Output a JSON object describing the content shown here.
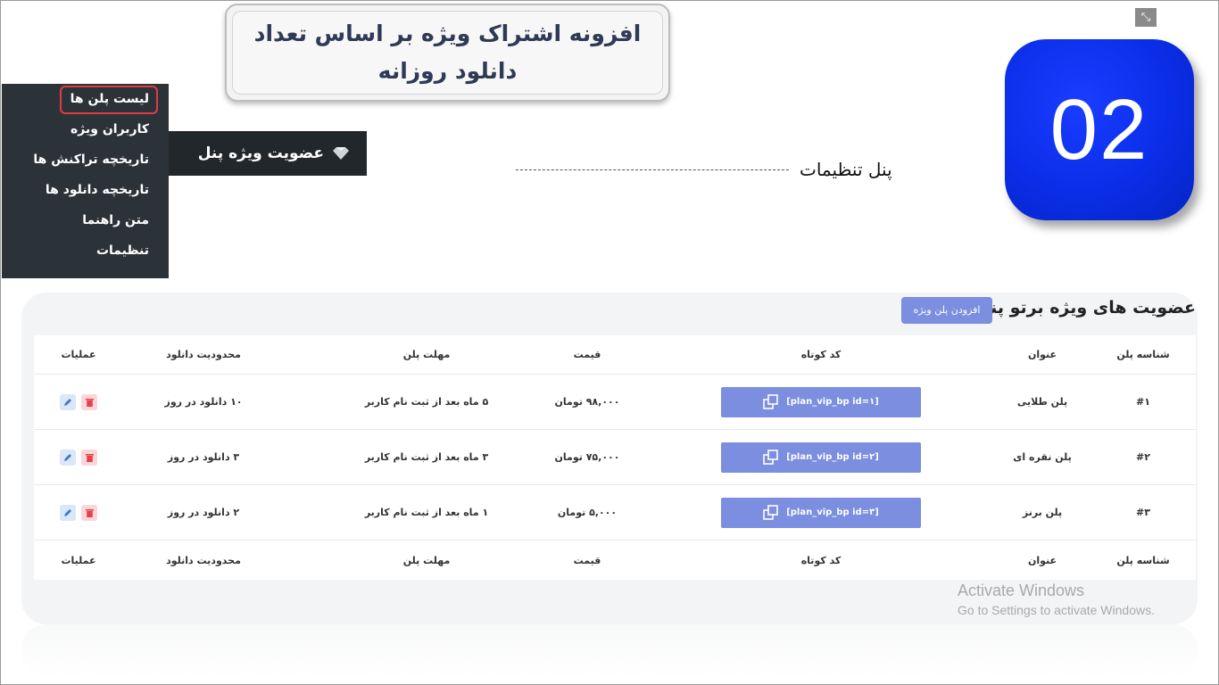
{
  "slide": {
    "title": "افزونه اشتراک ویژه بر اساس تعداد دانلود روزانه",
    "badge_number": "02",
    "callout": "پنل تنظیمات"
  },
  "menu": {
    "header": "عضویت ویژه پنل",
    "items": [
      {
        "label": "لیست پلن ها",
        "active": true
      },
      {
        "label": "کاربران ویژه"
      },
      {
        "label": "تاریخچه تراکنش ها"
      },
      {
        "label": "تاریخچه دانلود ها"
      },
      {
        "label": "متن راهنما"
      },
      {
        "label": "تنظیمات"
      }
    ]
  },
  "panel": {
    "title": "عضویت های ویژه برتو پنل",
    "add_button": "افزودن پلن ویژه",
    "columns": {
      "id": "شناسه پلن",
      "title": "عنوان",
      "code": "کد کوتاه",
      "price": "قیمت",
      "term": "مهلت پلن",
      "limit": "محدودیت دانلود",
      "ops": "عملیات"
    },
    "rows": [
      {
        "id": "#۱",
        "title": "پلن طلایی",
        "code": "[plan_vip_bp id=۱]",
        "price": "۹۸,۰۰۰ تومان",
        "term": "۵ ماه بعد از ثبت نام کاربر",
        "limit": "۱۰ دانلود در روز"
      },
      {
        "id": "#۲",
        "title": "پلن نقره ای",
        "code": "[plan_vip_bp id=۲]",
        "price": "۷۵,۰۰۰ تومان",
        "term": "۳ ماه بعد از ثبت نام کاربر",
        "limit": "۳ دانلود در روز"
      },
      {
        "id": "#۳",
        "title": "پلن برنز",
        "code": "[plan_vip_bp id=۳]",
        "price": "۵,۰۰۰ تومان",
        "term": "۱ ماه بعد از ثبت نام کاربر",
        "limit": "۲ دانلود در روز"
      }
    ]
  },
  "watermark": {
    "line1": "Activate Windows",
    "line2": "Go to Settings to activate Windows."
  },
  "colors": {
    "badge_blue": "#0a2ee8",
    "button_blue": "#7b8ee0",
    "menu_bg": "#2c3338",
    "active_ring": "#e23a45"
  }
}
